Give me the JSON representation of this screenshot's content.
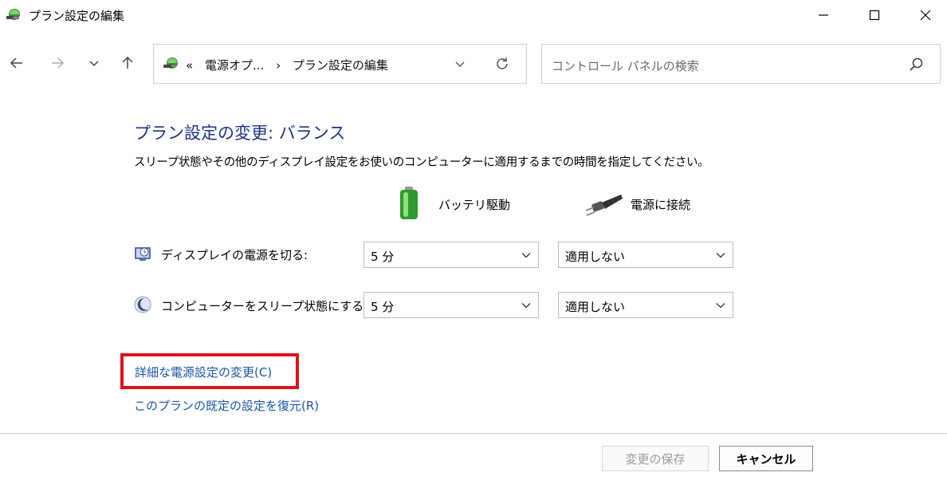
{
  "window": {
    "title": "プラン設定の編集",
    "minimize_icon": "minimize-icon",
    "maximize_icon": "maximize-icon",
    "close_icon": "close-icon"
  },
  "nav": {
    "back_icon": "arrow-left-icon",
    "forward_icon": "arrow-right-icon",
    "recent_icon": "chevron-down-icon",
    "up_icon": "arrow-up-icon",
    "address": {
      "prefix": "«",
      "crumb1": "電源オプ...",
      "sep": "›",
      "crumb2": "プラン設定の編集"
    },
    "search_placeholder": "コントロール パネルの検索"
  },
  "main": {
    "heading": "プラン設定の変更: バランス",
    "description": "スリープ状態やその他のディスプレイ設定をお使いのコンピューターに適用するまでの時間を指定してください。",
    "col_battery": "バッテリ駆動",
    "col_plugged": "電源に接続",
    "rows": [
      {
        "label": "ディスプレイの電源を切る:",
        "battery": "5 分",
        "plugged": "適用しない"
      },
      {
        "label": "コンピューターをスリープ状態にする:",
        "battery": "5 分",
        "plugged": "適用しない"
      }
    ],
    "link_advanced": "詳細な電源設定の変更(C)",
    "link_restore": "このプランの既定の設定を復元(R)"
  },
  "footer": {
    "save": "変更の保存",
    "cancel": "キャンセル"
  },
  "colors": {
    "heading": "#1e3287",
    "link": "#1b55a8",
    "highlight_box": "#e3101c"
  }
}
